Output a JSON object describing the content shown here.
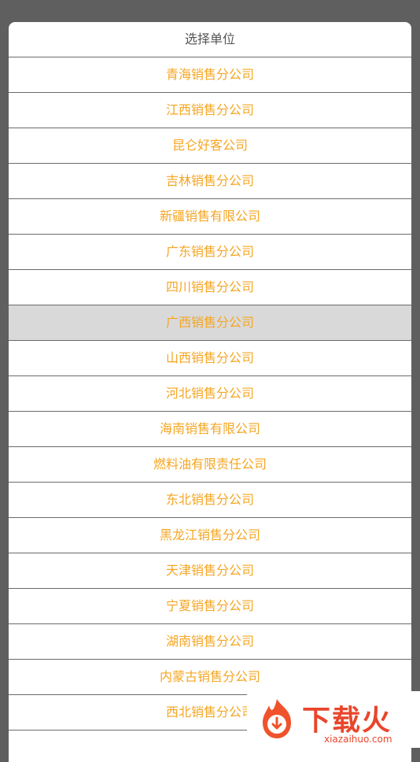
{
  "sheet": {
    "title": "选择单位",
    "options": [
      {
        "label": "青海销售分公司"
      },
      {
        "label": "江西销售分公司"
      },
      {
        "label": "昆仑好客公司"
      },
      {
        "label": "吉林销售分公司"
      },
      {
        "label": "新疆销售有限公司"
      },
      {
        "label": "广东销售分公司"
      },
      {
        "label": "四川销售分公司"
      },
      {
        "label": "广西销售分公司"
      },
      {
        "label": "山西销售分公司"
      },
      {
        "label": "河北销售分公司"
      },
      {
        "label": "海南销售有限公司"
      },
      {
        "label": "燃料油有限责任公司"
      },
      {
        "label": "东北销售分公司"
      },
      {
        "label": "黑龙江销售分公司"
      },
      {
        "label": "天津销售分公司"
      },
      {
        "label": "宁夏销售分公司"
      },
      {
        "label": "湖南销售分公司"
      },
      {
        "label": "内蒙古销售分公司"
      },
      {
        "label": "西北销售分公司"
      }
    ],
    "selected_index": 7
  },
  "watermark": {
    "text": "下载火",
    "url": "xiazaihuo.com"
  },
  "colors": {
    "option_text": "#f5a623",
    "selected_bg": "#d9d9d9",
    "overlay": "#5f5f5f"
  }
}
